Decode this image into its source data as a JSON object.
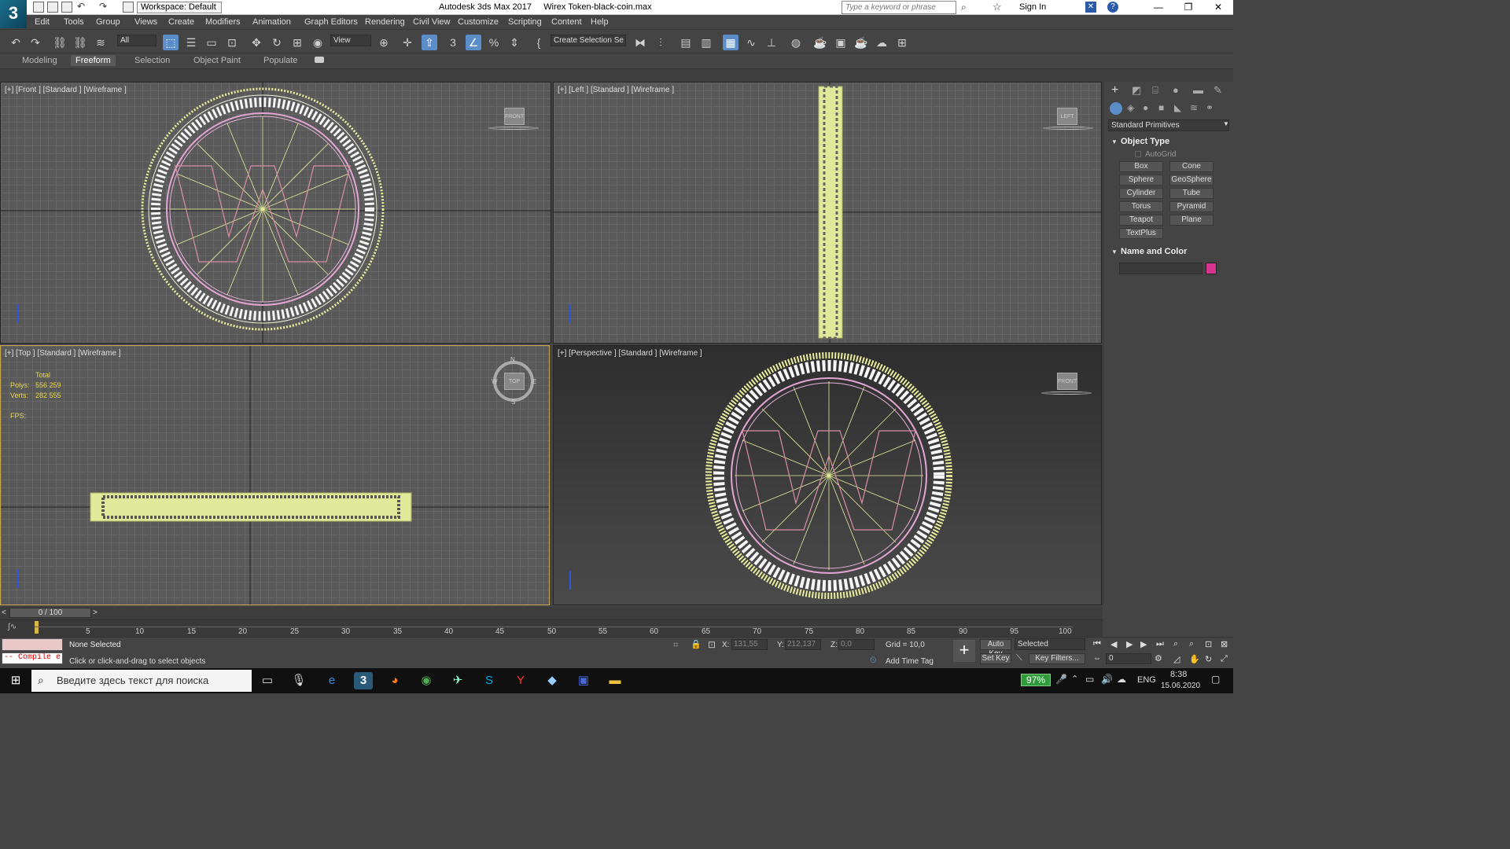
{
  "titlebar": {
    "workspace": "Workspace: Default",
    "app_title": "Autodesk 3ds Max 2017     Wirex Token-black-coin.max",
    "search_placeholder": "Type a keyword or phrase",
    "sign_in": "Sign In",
    "logo": "3"
  },
  "menu": [
    "Edit",
    "Tools",
    "Group",
    "Views",
    "Create",
    "Modifiers",
    "Animation",
    "Graph Editors",
    "Rendering",
    "Civil View",
    "Customize",
    "Scripting",
    "Content",
    "Help"
  ],
  "toolbar": {
    "filter": "All",
    "ref_coord": "View",
    "selection_set": "Create Selection Se"
  },
  "ribbon": {
    "tabs": [
      "Modeling",
      "Freeform",
      "Selection",
      "Object Paint",
      "Populate"
    ],
    "active": "Freeform"
  },
  "viewports": {
    "front": {
      "label": "[+] [Front ] [Standard ] [Wireframe ]",
      "cube": "FRONT"
    },
    "left": {
      "label": "[+] [Left ] [Standard ] [Wireframe ]",
      "cube": "LEFT"
    },
    "top": {
      "label": "[+] [Top ] [Standard ] [Wireframe ]",
      "cube": "TOP",
      "stats_total": "Total",
      "polys_label": "Polys:",
      "polys": "556 259",
      "verts_label": "Verts:",
      "verts": "282 555",
      "fps_label": "FPS:",
      "compass": {
        "n": "N",
        "s": "S",
        "w": "W",
        "e": "E"
      }
    },
    "perspective": {
      "label": "[+] [Perspective ] [Standard ] [Wireframe ]",
      "cube": "FRONT"
    }
  },
  "command_panel": {
    "category": "Standard Primitives",
    "object_type_title": "Object Type",
    "autogrid": "AutoGrid",
    "buttons": [
      "Box",
      "Cone",
      "Sphere",
      "GeoSphere",
      "Cylinder",
      "Tube",
      "Torus",
      "Pyramid",
      "Teapot",
      "Plane",
      "TextPlus"
    ],
    "name_color_title": "Name and Color",
    "color": "#d6358f"
  },
  "timeline": {
    "frame": "0 / 100",
    "ticks": [
      "5",
      "10",
      "15",
      "20",
      "25",
      "30",
      "35",
      "40",
      "45",
      "50",
      "55",
      "60",
      "65",
      "70",
      "75",
      "80",
      "85",
      "90",
      "95",
      "100"
    ]
  },
  "status": {
    "maxscript": "-- Compile e:",
    "selection": "None Selected",
    "prompt": "Click or click-and-drag to select objects",
    "x_label": "X:",
    "x": "131,55",
    "y_label": "Y:",
    "y": "212,137",
    "z_label": "Z:",
    "z": "0,0",
    "grid": "Grid = 10,0",
    "add_time_tag": "Add Time Tag",
    "auto_key": "Auto Key",
    "set_key": "Set Key",
    "key_mode": "Selected",
    "key_filters": "Key Filters...",
    "frame_field": "0"
  },
  "taskbar": {
    "search_placeholder": "Введите здесь текст для поиска",
    "battery": "97%",
    "lang": "ENG",
    "time": "8:38",
    "date": "15.06.2020"
  }
}
